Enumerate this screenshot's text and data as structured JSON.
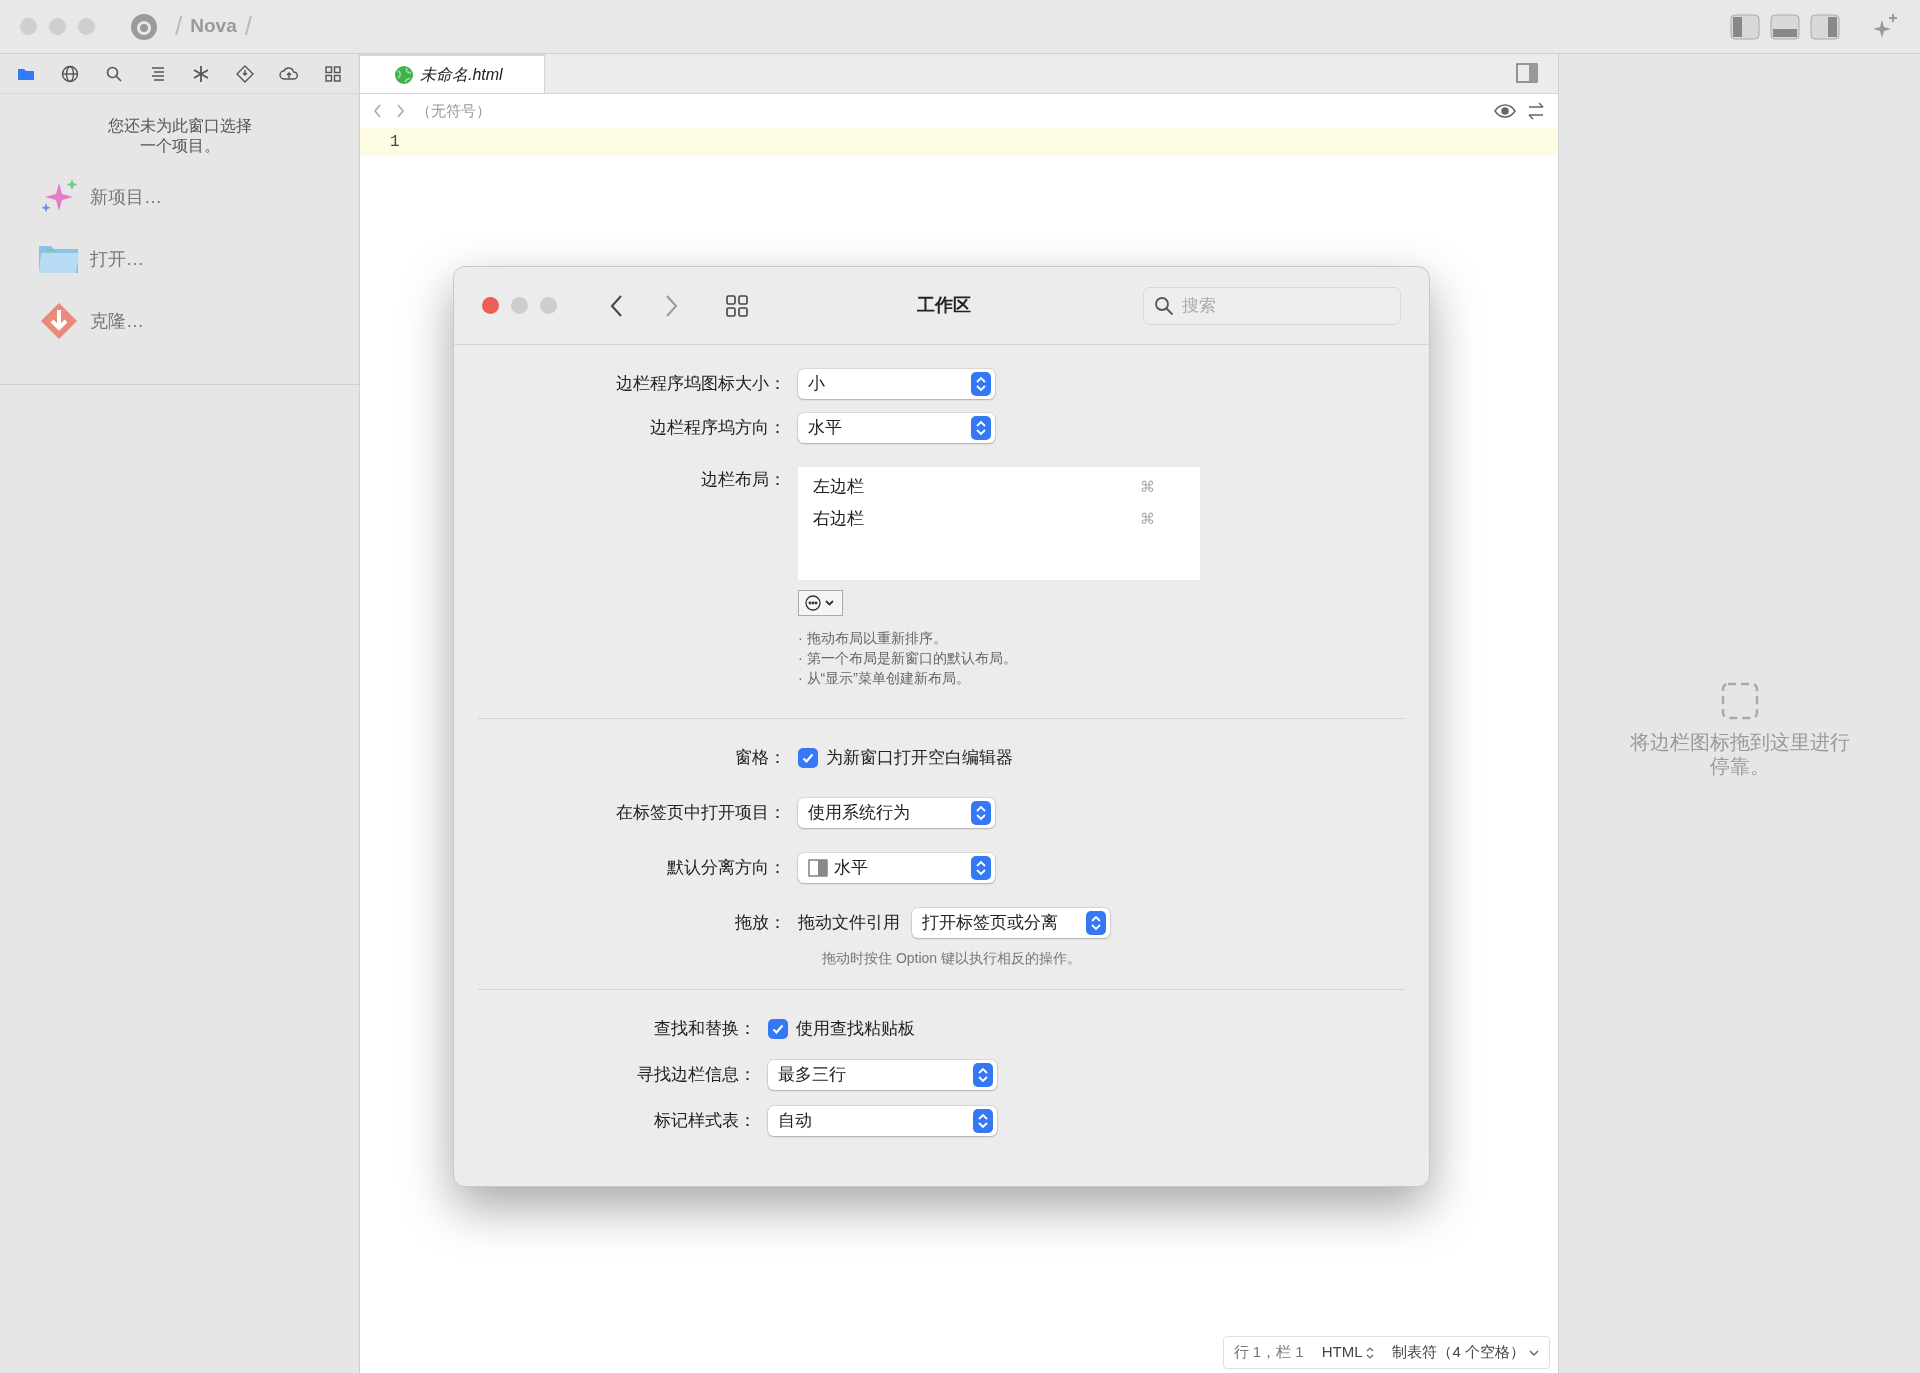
{
  "window": {
    "title_parts": [
      {
        "kind": "separator",
        "text": "/"
      },
      {
        "kind": "name",
        "text": "Nova"
      },
      {
        "kind": "separator",
        "text": "/"
      }
    ]
  },
  "sidebar_tools": [
    {
      "kind": "folder",
      "selected": true
    },
    {
      "kind": "globe",
      "selected": false
    },
    {
      "kind": "search",
      "selected": false
    },
    {
      "kind": "list",
      "selected": false
    },
    {
      "kind": "asterisk",
      "selected": false
    },
    {
      "kind": "diamond",
      "selected": false
    },
    {
      "kind": "cloud",
      "selected": false
    },
    {
      "kind": "grid",
      "selected": false
    }
  ],
  "sidebar": {
    "message_lines": [
      "您还未为此窗口选择",
      "一个项目。"
    ],
    "actions": [
      {
        "kind": "new",
        "label": "新项目…"
      },
      {
        "kind": "open",
        "label": "打开…"
      },
      {
        "kind": "clone",
        "label": "克隆…"
      }
    ]
  },
  "editor": {
    "tabs": [
      {
        "label": "未命名.html",
        "selected": true
      }
    ],
    "breadcrumb": "（无符号）",
    "line_numbers": [
      "1"
    ]
  },
  "dialog": {
    "title": "工作区",
    "search": {
      "placeholder": "搜索"
    },
    "sections": [
      {
        "rows": [
          {
            "kind": "popup",
            "label": "边栏程序坞图标大小：",
            "value": "小"
          },
          {
            "kind": "popup",
            "label": "边栏程序坞方向：",
            "value": "水平"
          },
          {
            "kind": "list",
            "label": "边栏布局：",
            "items": [
              {
                "label": "左边栏",
                "shortcut": "⌘"
              },
              {
                "label": "右边栏",
                "shortcut": "⌘"
              }
            ],
            "notes": [
              "· 拖动布局以重新排序。",
              "· 第一个布局是新窗口的默认布局。",
              "· 从“显示”菜单创建新布局。"
            ]
          }
        ]
      },
      {
        "rows": [
          {
            "kind": "checkbox",
            "label": "窗格：",
            "text": "为新窗口打开空白编辑器",
            "checked": true
          },
          {
            "kind": "popup",
            "label": "在标签页中打开项目：",
            "value": "使用系统行为"
          },
          {
            "kind": "split_popup",
            "label": "默认分离方向：",
            "value": "水平"
          },
          {
            "kind": "drop",
            "label": "拖放：",
            "text": "拖动文件引用",
            "value": "打开标签页或分离",
            "hint": "拖动时按住 Option 键以执行相反的操作。"
          }
        ]
      },
      {
        "rows": [
          {
            "kind": "checkbox",
            "label": "查找和替换：",
            "text": "使用查找粘贴板",
            "checked": true
          },
          {
            "kind": "popup",
            "label": "寻找边栏信息：",
            "value": "最多三行"
          },
          {
            "kind": "popup",
            "label": "标记样式表：",
            "value": "自动"
          }
        ]
      }
    ]
  },
  "dock_panel": {
    "message_lines": [
      "将边栏图标拖到这里进行",
      "停靠。"
    ]
  },
  "status_bar": {
    "position": "行 1，栏 1",
    "syntax": "HTML",
    "indentation": "制表符（4 个空格）"
  }
}
